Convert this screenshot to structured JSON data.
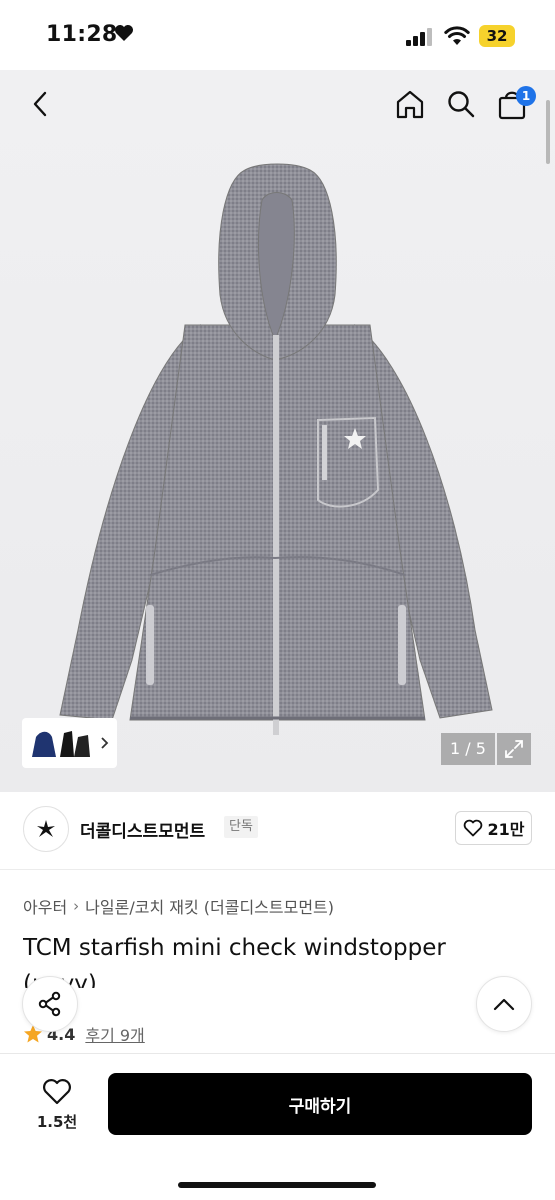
{
  "status": {
    "time": "11:28",
    "battery": "32"
  },
  "nav": {
    "cart_count": "1"
  },
  "gallery": {
    "counter": "1 / 5"
  },
  "brand": {
    "name": "더콜디스트모먼트",
    "badge": "단독",
    "likes": "21만"
  },
  "breadcrumb": {
    "items": [
      "아우터",
      "나일론/코치 재킷 (더콜디스트모먼트)"
    ]
  },
  "product": {
    "title": "TCM starfish mini check windstopper (navy)"
  },
  "rating": {
    "value": "4.4",
    "reviews": "후기 9개"
  },
  "bottom": {
    "wish_count": "1.5천",
    "buy_label": "구매하기"
  },
  "colors": {
    "accent_badge": "#1f73e8",
    "buy_button": "#000000",
    "battery": "#f6d22c",
    "star": "#f5a623"
  }
}
